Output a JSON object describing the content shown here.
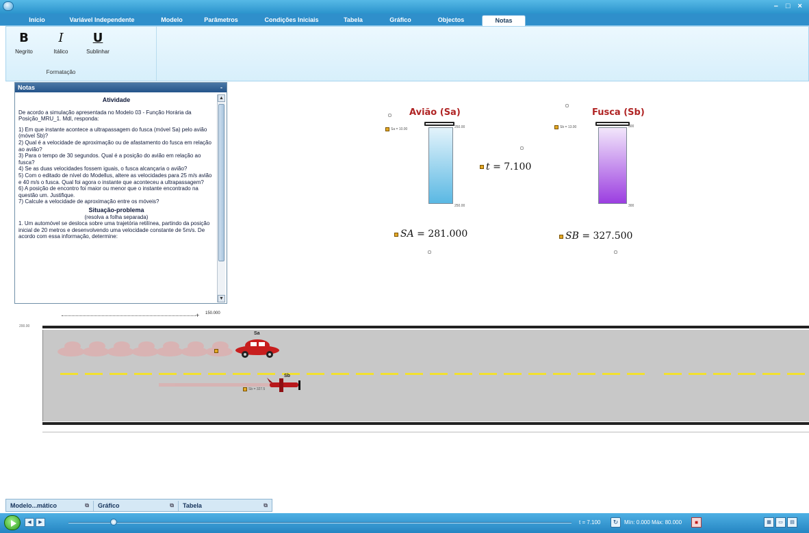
{
  "window": {
    "controls": "– □ ×"
  },
  "tabs": [
    {
      "label": "Início"
    },
    {
      "label": "Variável Independente"
    },
    {
      "label": "Modelo"
    },
    {
      "label": "Parâmetros"
    },
    {
      "label": "Condições Iniciais"
    },
    {
      "label": "Tabela"
    },
    {
      "label": "Gráfico"
    },
    {
      "label": "Objectos"
    },
    {
      "label": "Notas",
      "active": true
    }
  ],
  "ribbon": {
    "bold": {
      "glyph": "B",
      "label": "Negrito"
    },
    "italic": {
      "glyph": "I",
      "label": "Itálico"
    },
    "underline": {
      "glyph": "U",
      "label": "Sublinhar"
    },
    "group_label": "Formatação"
  },
  "notes": {
    "title": "Notas",
    "collapse": "-",
    "heading": "Atividade",
    "intro": "De acordo a simulação apresentada no Modelo 03 - Função Horária da Posição_MRU_1. Mdl, responda:",
    "q1": "1) Em que instante acontece a ultrapassagem do fusca (móvel Sa) pelo avião (móvel Sb)?",
    "q2": "2) Qual é a velocidade de aproximação ou de afastamento do fusca em relação ao avião?",
    "q3": "3) Para o tempo de 30 segundos. Qual é a posição do avião em relação ao fusca?",
    "q4": "4) Se as duas velocidades fossem iguais, o fusca alcançaria o avião?",
    "q5": "5) Com o editado de nível do Modellus, altere as velocidades para 25 m/s avião e 40 m/s o fusca. Qual foi agora o instante que aconteceu a ultrapassagem?",
    "q6": "6) A posição de encontro foi maior ou menor que o instante encontrado na questão um. Justifique.",
    "q7": "7) Calcule a velocidade de aproximação entre os móveis?",
    "problem_title": "Situação-problema",
    "problem_sub": "(resolva a folha separada)",
    "problem_text": "1. Um automóvel se desloca sobre uma trajetória retilínea, partindo da posição inicial de 20 metros e desenvolvendo uma velocidade constante de 5m/s. De acordo com essa informação, determine:"
  },
  "gauges": {
    "a": {
      "title": "Avião (Sa)",
      "fill_color": "#5ab8e3"
    },
    "b": {
      "title": "Fusca (Sb)",
      "fill_color": "#9b3ee0"
    }
  },
  "equations": {
    "t": {
      "var": "t",
      "value": "= 7.100"
    },
    "sa": {
      "var": "SA",
      "value": "= 281.000"
    },
    "sb": {
      "var": "SB",
      "value": "= 327.500"
    }
  },
  "road": {
    "slider_value": "150.000",
    "lane_label_car": "Sa",
    "lane_label_plane": "Sb"
  },
  "bottom_tabs": [
    {
      "label": "Modelo...mático"
    },
    {
      "label": "Gráfico"
    },
    {
      "label": "Tabela"
    }
  ],
  "status": {
    "time": "t = 7.100",
    "range": "Mín: 0.000 Máx: 80.000",
    "stop_icon_label": "■"
  }
}
